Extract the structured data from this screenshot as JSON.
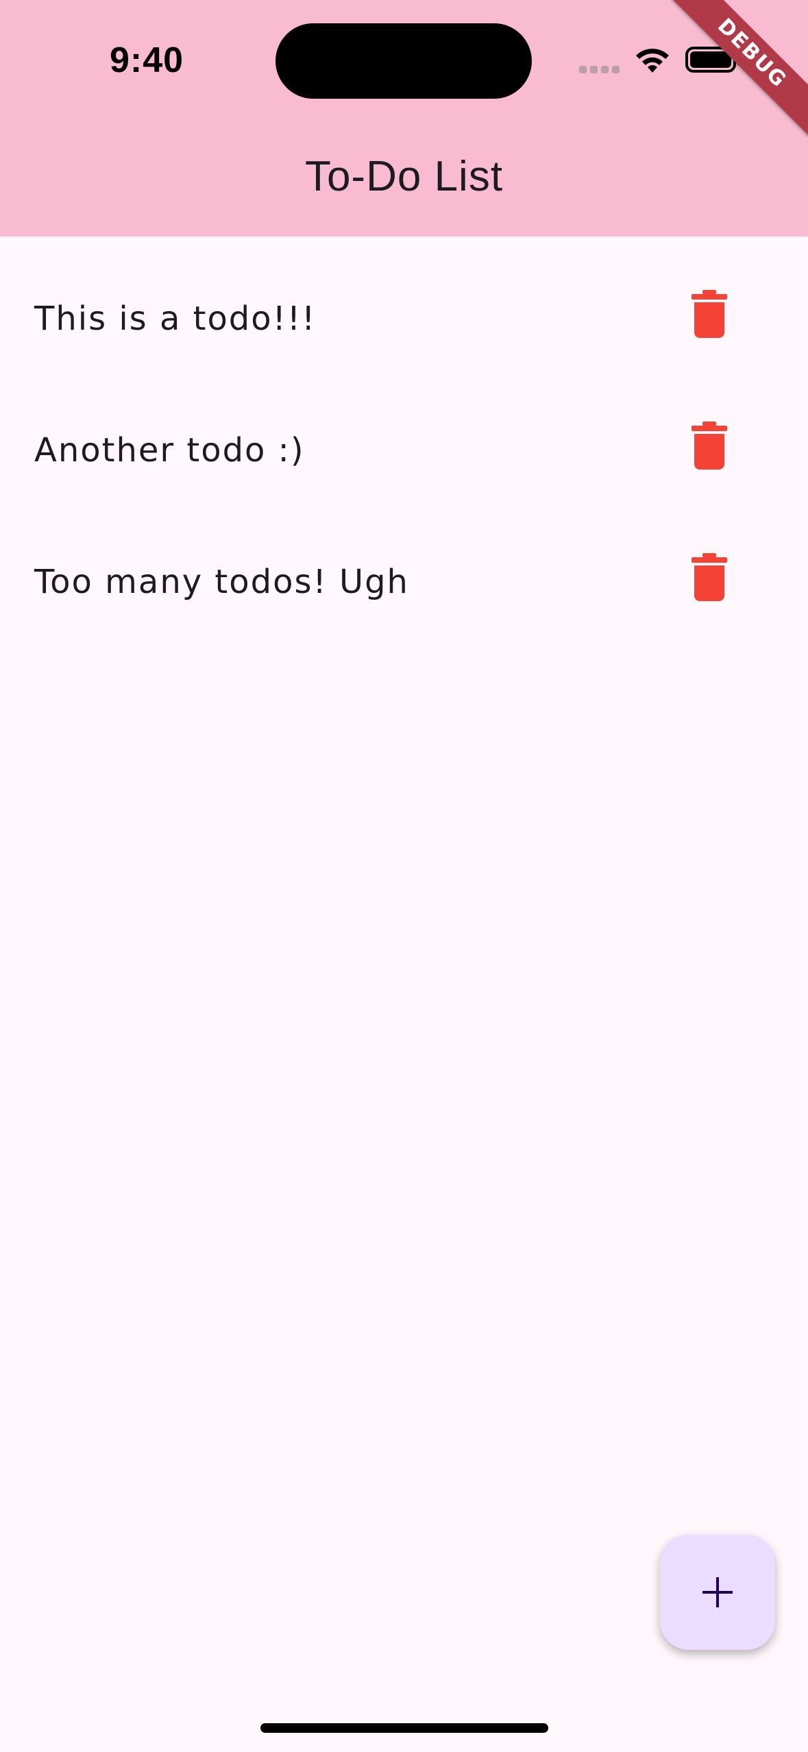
{
  "status_bar": {
    "time": "9:40"
  },
  "app_bar": {
    "title": "To-Do List",
    "background_color": "#f8bbd0"
  },
  "debug_banner": {
    "label": "DEBUG"
  },
  "todos": [
    {
      "text": "This is a todo!!!"
    },
    {
      "text": "Another todo :)"
    },
    {
      "text": "Too many todos! Ugh"
    }
  ],
  "icons": {
    "delete": "trash-icon",
    "add": "plus-icon",
    "wifi": "wifi-icon",
    "battery": "battery-icon"
  },
  "colors": {
    "accent_delete": "#f44336",
    "fab_background": "#eaddff",
    "fab_icon": "#21005d",
    "page_background": "#fef7fb"
  }
}
